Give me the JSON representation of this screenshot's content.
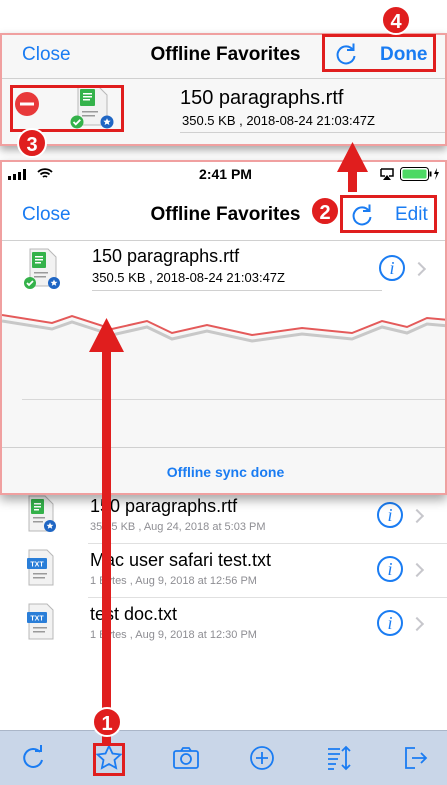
{
  "top_popup": {
    "close_label": "Close",
    "title": "Offline Favorites",
    "done_label": "Done",
    "file": {
      "name": "150 paragraphs.rtf",
      "meta": "350.5 KB , 2018-08-24 21:03:47Z"
    }
  },
  "status_bar": {
    "time": "2:41 PM"
  },
  "mid_popup": {
    "close_label": "Close",
    "title": "Offline Favorites",
    "edit_label": "Edit",
    "file": {
      "name": "150 paragraphs.rtf",
      "meta": "350.5 KB , 2018-08-24 21:03:47Z"
    },
    "footer_text": "Offline sync done"
  },
  "background_list": [
    {
      "name": "150 paragraphs.rtf",
      "meta": "350.5 KB , Aug 24, 2018 at 5:03 PM",
      "icon": "rtf-favorite-icon"
    },
    {
      "name": "Mac user safari test.txt",
      "meta": "1 Bytes , Aug 9, 2018 at 12:56 PM",
      "icon": "txt-file-icon"
    },
    {
      "name": "test doc.txt",
      "meta": "1 Bytes , Aug 9, 2018 at 12:30 PM",
      "icon": "txt-file-icon"
    }
  ],
  "file_badge_text": "TXT",
  "annotations": {
    "step1": "1",
    "step2": "2",
    "step3": "3",
    "step4": "4"
  },
  "toolbar": [
    "refresh-icon",
    "star-icon",
    "camera-icon",
    "add-icon",
    "sort-icon",
    "logout-icon"
  ],
  "colors": {
    "accent": "#1a7cf2",
    "annotation_red": "#e01e1e",
    "toolbar_bg": "#c9d6e8"
  }
}
